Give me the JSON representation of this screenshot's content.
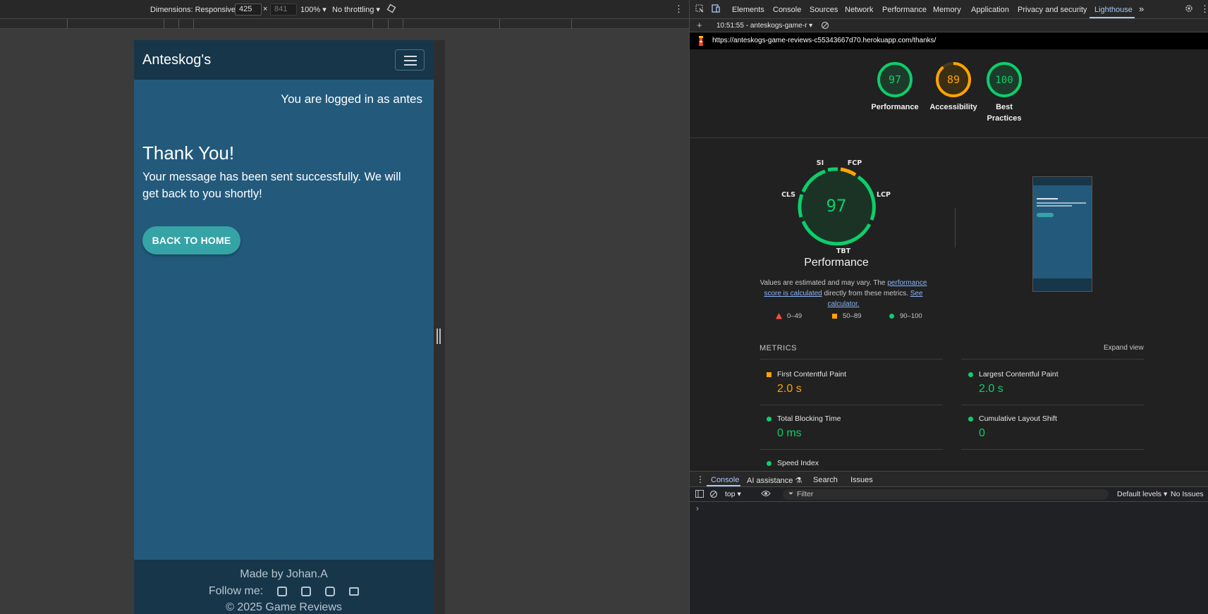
{
  "device_toolbar": {
    "dimensions_label": "Dimensions: Responsive",
    "width": "425",
    "times": "×",
    "height": "841",
    "zoom": "100%",
    "throttle": "No throttling"
  },
  "site": {
    "brand": "Anteskog's",
    "logged_in": "You are logged in as antes",
    "thanks_title": "Thank You!",
    "thanks_message": "Your message has been sent successfully. We will get back to you shortly!",
    "back_button": "BACK TO HOME",
    "footer": {
      "made_by": "Made by Johan.A",
      "follow": "Follow me:",
      "copyright": "© 2025 Game Reviews"
    }
  },
  "devtools": {
    "tabs": [
      "Elements",
      "Console",
      "Sources",
      "Network",
      "Performance",
      "Memory",
      "Application",
      "Privacy and security",
      "Lighthouse"
    ],
    "more": "»",
    "lighthouse_session": "10:51:55 - anteskogs-game-r",
    "url": "https://anteskogs-game-reviews-c55343667d70.herokuapp.com/thanks/",
    "summary_gauges": [
      {
        "score": "97",
        "label": "Performance",
        "color": "#0cce6b"
      },
      {
        "score": "89",
        "label": "Accessibility",
        "color": "#ffa400"
      },
      {
        "score": "100",
        "label": "Best Practices",
        "color": "#0cce6b"
      }
    ],
    "big_gauge": {
      "score": "97",
      "title": "Performance",
      "segments": {
        "si": "SI",
        "fcp": "FCP",
        "lcp": "LCP",
        "tbt": "TBT",
        "cls": "CLS"
      }
    },
    "note": {
      "part1": "Values are estimated and may vary. The ",
      "link1": "performance score is calculated",
      "part2": " directly from these metrics. ",
      "link2": "See calculator."
    },
    "legend": [
      {
        "range": "0–49",
        "color": "#ff4e42"
      },
      {
        "range": "50–89",
        "color": "#ffa400"
      },
      {
        "range": "90–100",
        "color": "#0cce6b"
      }
    ],
    "metrics_title": "METRICS",
    "expand_view": "Expand view",
    "metrics": [
      {
        "name": "First Contentful Paint",
        "value": "2.0 s",
        "status": "average",
        "color": "#ffa400"
      },
      {
        "name": "Largest Contentful Paint",
        "value": "2.0 s",
        "status": "pass",
        "color": "#0cce6b"
      },
      {
        "name": "Total Blocking Time",
        "value": "0 ms",
        "status": "pass",
        "color": "#0cce6b"
      },
      {
        "name": "Cumulative Layout Shift",
        "value": "0",
        "status": "pass",
        "color": "#0cce6b"
      },
      {
        "name": "Speed Index",
        "value": "",
        "status": "pass",
        "color": "#0cce6b"
      }
    ],
    "drawer": {
      "tabs": [
        "Console",
        "AI assistance",
        "Search",
        "Issues"
      ],
      "context": "top",
      "filter_placeholder": "Filter",
      "levels": "Default levels",
      "issues": "No Issues",
      "prompt": "›"
    }
  }
}
